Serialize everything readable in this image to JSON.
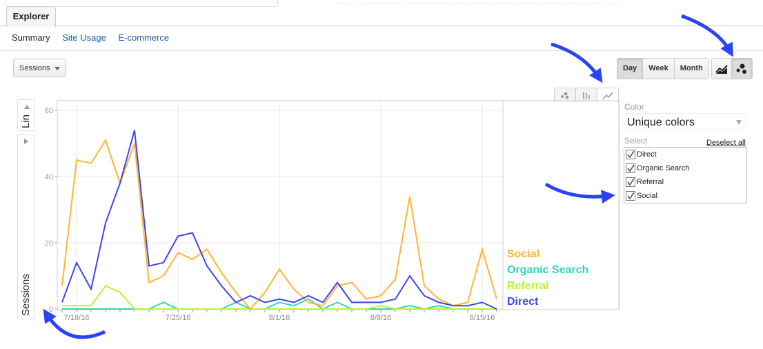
{
  "tabs": {
    "explorer": "Explorer"
  },
  "subnav": {
    "summary": "Summary",
    "site_usage": "Site Usage",
    "ecommerce": "E-commerce"
  },
  "metric_dropdown": {
    "value": "Sessions"
  },
  "period_buttons": {
    "day": "Day",
    "week": "Week",
    "month": "Month",
    "active": "Day"
  },
  "view_toggle": {
    "active": "motion-chart"
  },
  "motion_chart": {
    "y_scale_label": "Lin",
    "y_metric_label": "Sessions",
    "color_label": "Color",
    "color_value": "Unique colors",
    "select_label": "Select",
    "deselect_all": "Deselect all",
    "active_chart_tab": "line",
    "select_items": [
      {
        "label": "Direct",
        "checked": true
      },
      {
        "label": "Organic Search",
        "checked": true
      },
      {
        "label": "Referral",
        "checked": true
      },
      {
        "label": "Social",
        "checked": true
      }
    ]
  },
  "chart_data": {
    "type": "line",
    "title": "",
    "xlabel": "",
    "ylabel": "Sessions",
    "ylim": [
      0,
      60
    ],
    "yticks": [
      0,
      20,
      40,
      60
    ],
    "grid": true,
    "legend_position": "right-inside-bottom",
    "x": [
      "7/17/16",
      "7/18/16",
      "7/19/16",
      "7/20/16",
      "7/21/16",
      "7/22/16",
      "7/23/16",
      "7/24/16",
      "7/25/16",
      "7/26/16",
      "7/27/16",
      "7/28/16",
      "7/29/16",
      "7/30/16",
      "7/31/16",
      "8/1/16",
      "8/2/16",
      "8/3/16",
      "8/4/16",
      "8/5/16",
      "8/6/16",
      "8/7/16",
      "8/8/16",
      "8/9/16",
      "8/10/16",
      "8/11/16",
      "8/12/16",
      "8/13/16",
      "8/14/16",
      "8/15/16",
      "8/16/16"
    ],
    "xtick_labels": [
      "7/18/16",
      "7/25/16",
      "8/1/16",
      "8/8/16",
      "8/15/16"
    ],
    "series": [
      {
        "name": "Social",
        "color": "#ffb52e",
        "values": [
          7,
          45,
          44,
          51,
          38,
          50,
          8,
          10,
          17,
          15,
          18,
          11,
          5,
          0,
          5,
          12,
          6,
          2,
          1,
          7,
          8,
          3,
          4,
          9,
          34,
          7,
          3,
          1,
          2,
          18,
          3
        ]
      },
      {
        "name": "Organic Search",
        "color": "#2fd6b8",
        "values": [
          0,
          0,
          0,
          0,
          0,
          0,
          0,
          2,
          0,
          0,
          0,
          0,
          2,
          0,
          0,
          2,
          1,
          3,
          0,
          2,
          0,
          0,
          0,
          0,
          1,
          0,
          1,
          0,
          0,
          0,
          0
        ]
      },
      {
        "name": "Referral",
        "color": "#b8f530",
        "values": [
          1,
          1,
          1,
          7,
          5,
          0,
          0,
          0,
          0,
          0,
          0,
          0,
          0,
          0,
          0,
          0,
          0,
          0,
          0,
          0,
          0,
          0,
          1,
          0,
          0,
          0,
          0,
          0,
          0,
          0,
          0
        ]
      },
      {
        "name": "Direct",
        "color": "#3f45ee",
        "values": [
          2,
          14,
          6,
          26,
          38,
          54,
          13,
          14,
          22,
          23,
          13,
          7,
          2,
          4,
          2,
          3,
          2,
          4,
          2,
          8,
          2,
          2,
          2,
          3,
          10,
          4,
          2,
          1,
          1,
          2,
          0
        ]
      }
    ]
  }
}
